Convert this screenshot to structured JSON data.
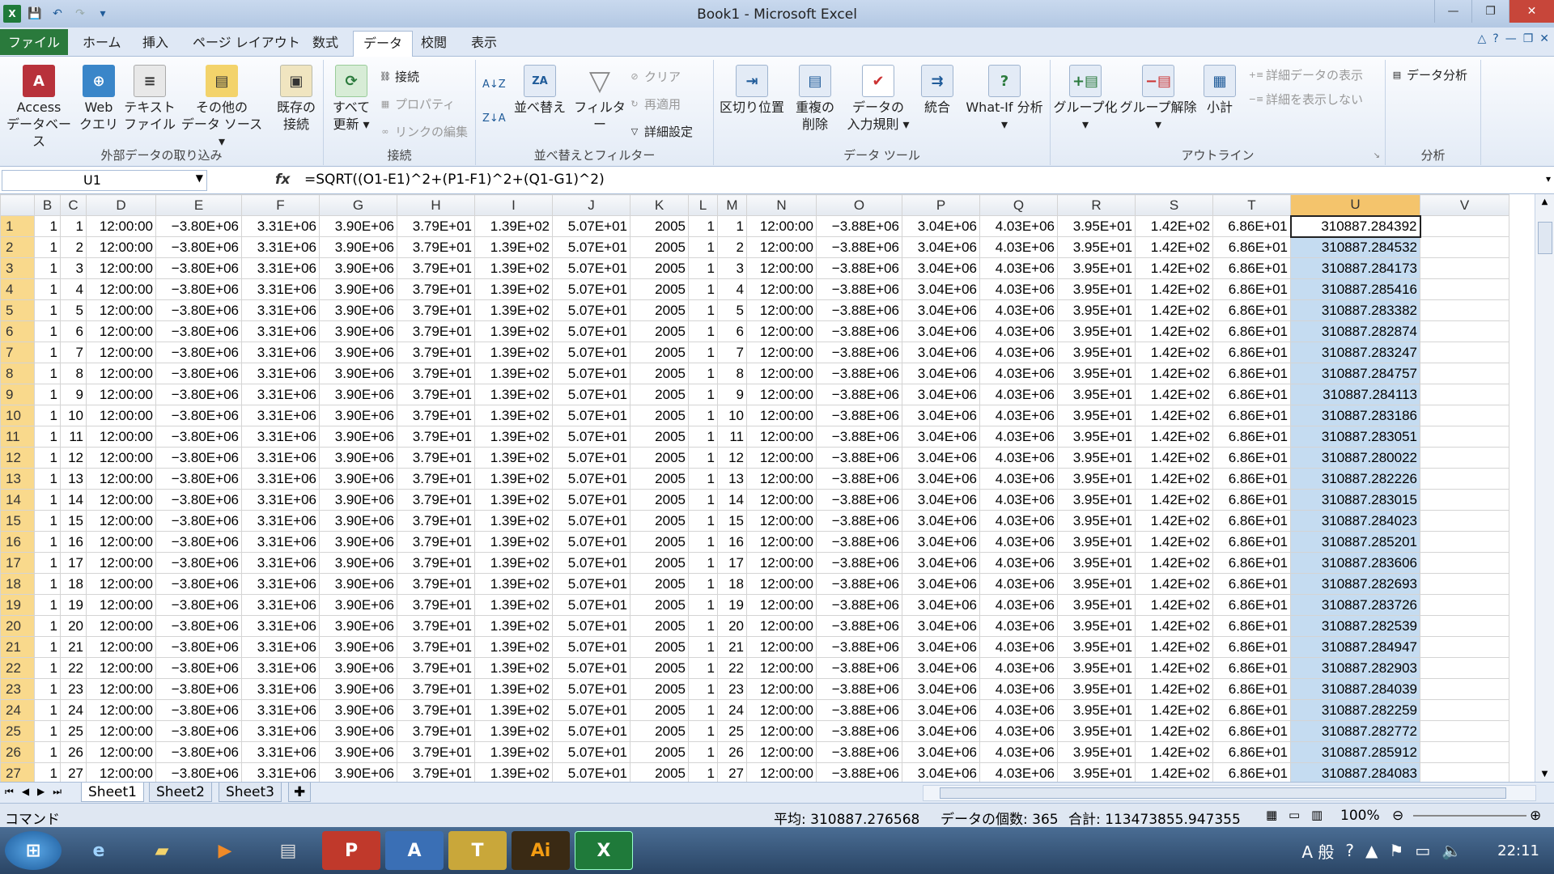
{
  "window": {
    "title": "Book1 - Microsoft Excel",
    "min": "—",
    "max": "❐",
    "close": "✕"
  },
  "tabs": [
    "ファイル",
    "ホーム",
    "挿入",
    "ページ レイアウト",
    "数式",
    "データ",
    "校閲",
    "表示"
  ],
  "ribbon": {
    "ext": {
      "access": "Access\nデータベース",
      "web": "Web\nクエリ",
      "text": "テキスト\nファイル",
      "other": "その他の\nデータ ソース ▾",
      "label": "外部データの取り込み"
    },
    "conn": {
      "existing": "既存の\n接続",
      "refresh": "すべて\n更新 ▾",
      "connect": "接続",
      "props": "プロパティ",
      "editlinks": "リンクの編集",
      "label": "接続"
    },
    "sort": {
      "sort": "並べ替え",
      "filter": "フィルター",
      "clear": "クリア",
      "reapply": "再適用",
      "advanced": "詳細設定",
      "label": "並べ替えとフィルター"
    },
    "tools": {
      "split": "区切り位置",
      "dup": "重複の\n削除",
      "valid": "データの\n入力規則 ▾",
      "consol": "統合",
      "whatif": "What-If 分析\n▾",
      "label": "データ ツール"
    },
    "outline": {
      "group": "グループ化\n▾",
      "ungroup": "グループ解除\n▾",
      "subtotal": "小計",
      "show": "詳細データの表示",
      "hide": "詳細を表示しない",
      "label": "アウトライン"
    },
    "analysis": {
      "btn": "データ分析",
      "label": "分析"
    }
  },
  "formula_bar": {
    "cell": "U1",
    "fx": "fx",
    "formula": "=SQRT((O1-E1)^2+(P1-F1)^2+(Q1-G1)^2)"
  },
  "columns": [
    "B",
    "C",
    "D",
    "E",
    "F",
    "G",
    "H",
    "I",
    "J",
    "K",
    "L",
    "M",
    "N",
    "O",
    "P",
    "Q",
    "R",
    "S",
    "T",
    "U",
    "V"
  ],
  "fixed": {
    "b": "1",
    "d": "12:00:00",
    "e": "−3.80E+06",
    "f": "3.31E+06",
    "g": "3.90E+06",
    "h": "3.79E+01",
    "i": "1.39E+02",
    "j": "5.07E+01",
    "k": "2005",
    "l": "1",
    "n": "12:00:00",
    "o": "−3.88E+06",
    "p": "3.04E+06",
    "q": "4.03E+06",
    "r": "3.95E+01",
    "s": "1.42E+02",
    "t": "6.86E+01"
  },
  "u_values": [
    "310887.284392",
    "310887.284532",
    "310887.284173",
    "310887.285416",
    "310887.283382",
    "310887.282874",
    "310887.283247",
    "310887.284757",
    "310887.284113",
    "310887.283186",
    "310887.283051",
    "310887.280022",
    "310887.282226",
    "310887.283015",
    "310887.284023",
    "310887.285201",
    "310887.283606",
    "310887.282693",
    "310887.283726",
    "310887.282539",
    "310887.284947",
    "310887.282903",
    "310887.284039",
    "310887.282259",
    "310887.282772",
    "310887.285912",
    "310887.284083"
  ],
  "sheets": [
    "Sheet1",
    "Sheet2",
    "Sheet3"
  ],
  "status": {
    "mode": "コマンド",
    "avg": "平均: 310887.276568",
    "count": "データの個数: 365",
    "sum": "合計: 113473855.947355",
    "zoom": "100%"
  },
  "taskbar": {
    "time": "22:11",
    "ime": "A 般"
  }
}
